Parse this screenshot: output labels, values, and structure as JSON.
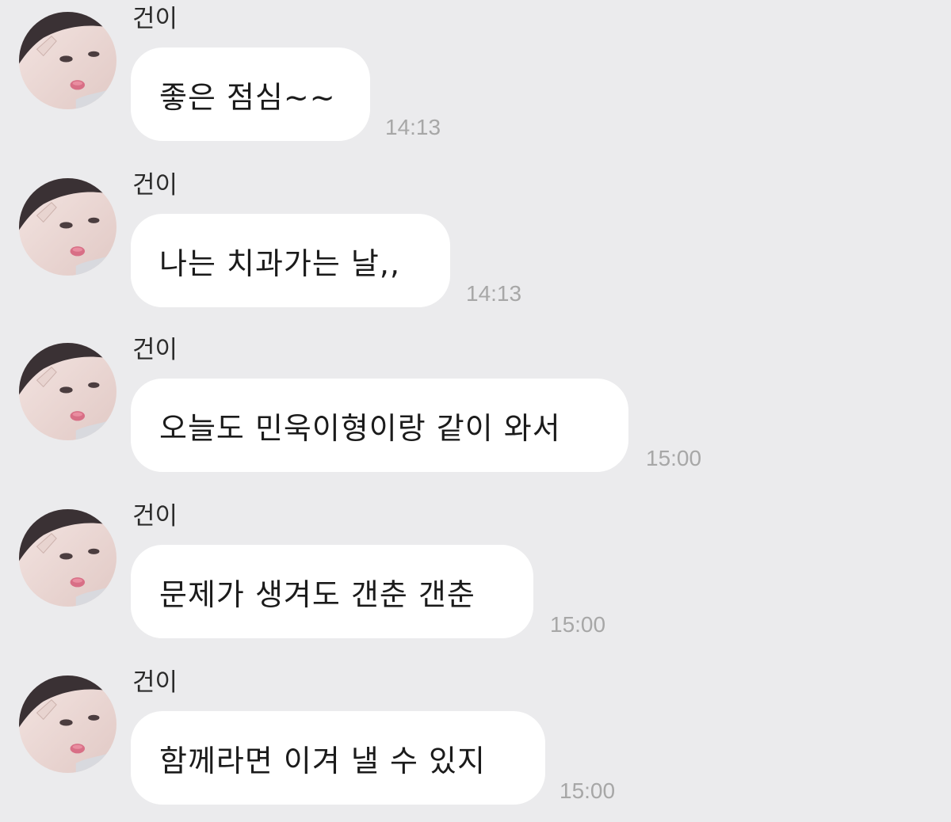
{
  "chat": {
    "messages": [
      {
        "sender": "건이",
        "text": "좋은 점심~~",
        "time": "14:13"
      },
      {
        "sender": "건이",
        "text": "나는 치과가는 날,,",
        "time": "14:13"
      },
      {
        "sender": "건이",
        "text": "오늘도 민욱이형이랑 같이 와서",
        "time": "15:00"
      },
      {
        "sender": "건이",
        "text": "문제가 생겨도 갠춘 갠춘",
        "time": "15:00"
      },
      {
        "sender": "건이",
        "text": "함께라면 이겨 낼 수 있지",
        "time": "15:00"
      }
    ]
  },
  "colors": {
    "background": "#ebebed",
    "bubble": "#ffffff",
    "timestamp": "#a7a7a7"
  }
}
